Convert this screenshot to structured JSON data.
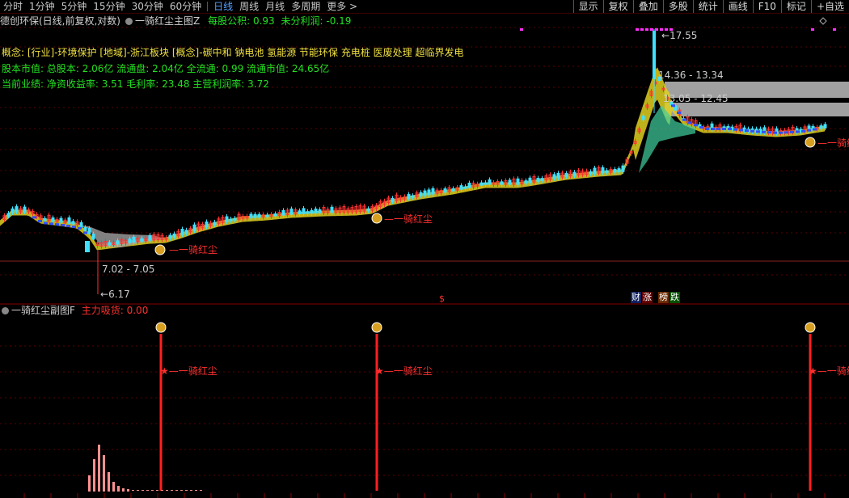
{
  "toolbar": {
    "periods": [
      "分时",
      "1分钟",
      "5分钟",
      "15分钟",
      "30分钟",
      "60分钟",
      "日线",
      "周线",
      "月线",
      "多周期",
      "更多"
    ],
    "active_period": "日线",
    "more_icon": "chevron-right-icon",
    "buttons": [
      "显示",
      "复权",
      "叠加",
      "多股",
      "统计",
      "画线",
      "F10",
      "标记",
      "+自选"
    ]
  },
  "main_header": {
    "stock": "德创环保(日线,前复权,对数)",
    "indicator": "一骑红尘主图Z",
    "eps_label": "每股公积:",
    "eps_value": "0.93",
    "profit_label": "未分利润:",
    "profit_value": "-0.19"
  },
  "info": {
    "concepts": "概念: [行业]-环境保护 [地域]-浙江板块 [概念]-碳中和 钠电池 氢能源 节能环保 充电桩 医废处理 超临界发电",
    "capital": "股本市值: 总股本: 2.06亿 流通盘: 2.04亿 全流通: 0.99 流通市值: 24.65亿",
    "performance": "当前业绩: 净资收益率: 3.51 毛利率: 23.48 主营利润率: 3.72"
  },
  "price_labels": {
    "high": "17.55",
    "range_upper": "14.36 - 13.34",
    "range_lower": "13.05 - 12.45",
    "range_bottom": "7.02 - 7.05",
    "low": "6.17"
  },
  "signal_label": "一骑红尘",
  "signal_label_cut": "一骑红",
  "badges": {
    "cai": "财",
    "zhang": "涨",
    "bang": "榜",
    "die": "跌",
    "dollar": "$"
  },
  "sub_header": {
    "indicator": "一骑红尘副图F",
    "label": "主力吸货:",
    "value": "0.00"
  },
  "colors": {
    "up": "#ff3232",
    "down": "#40e0ff",
    "band_up": "#e0d020",
    "band_down": "#a0a0a0",
    "signal": "#ff2020"
  }
}
